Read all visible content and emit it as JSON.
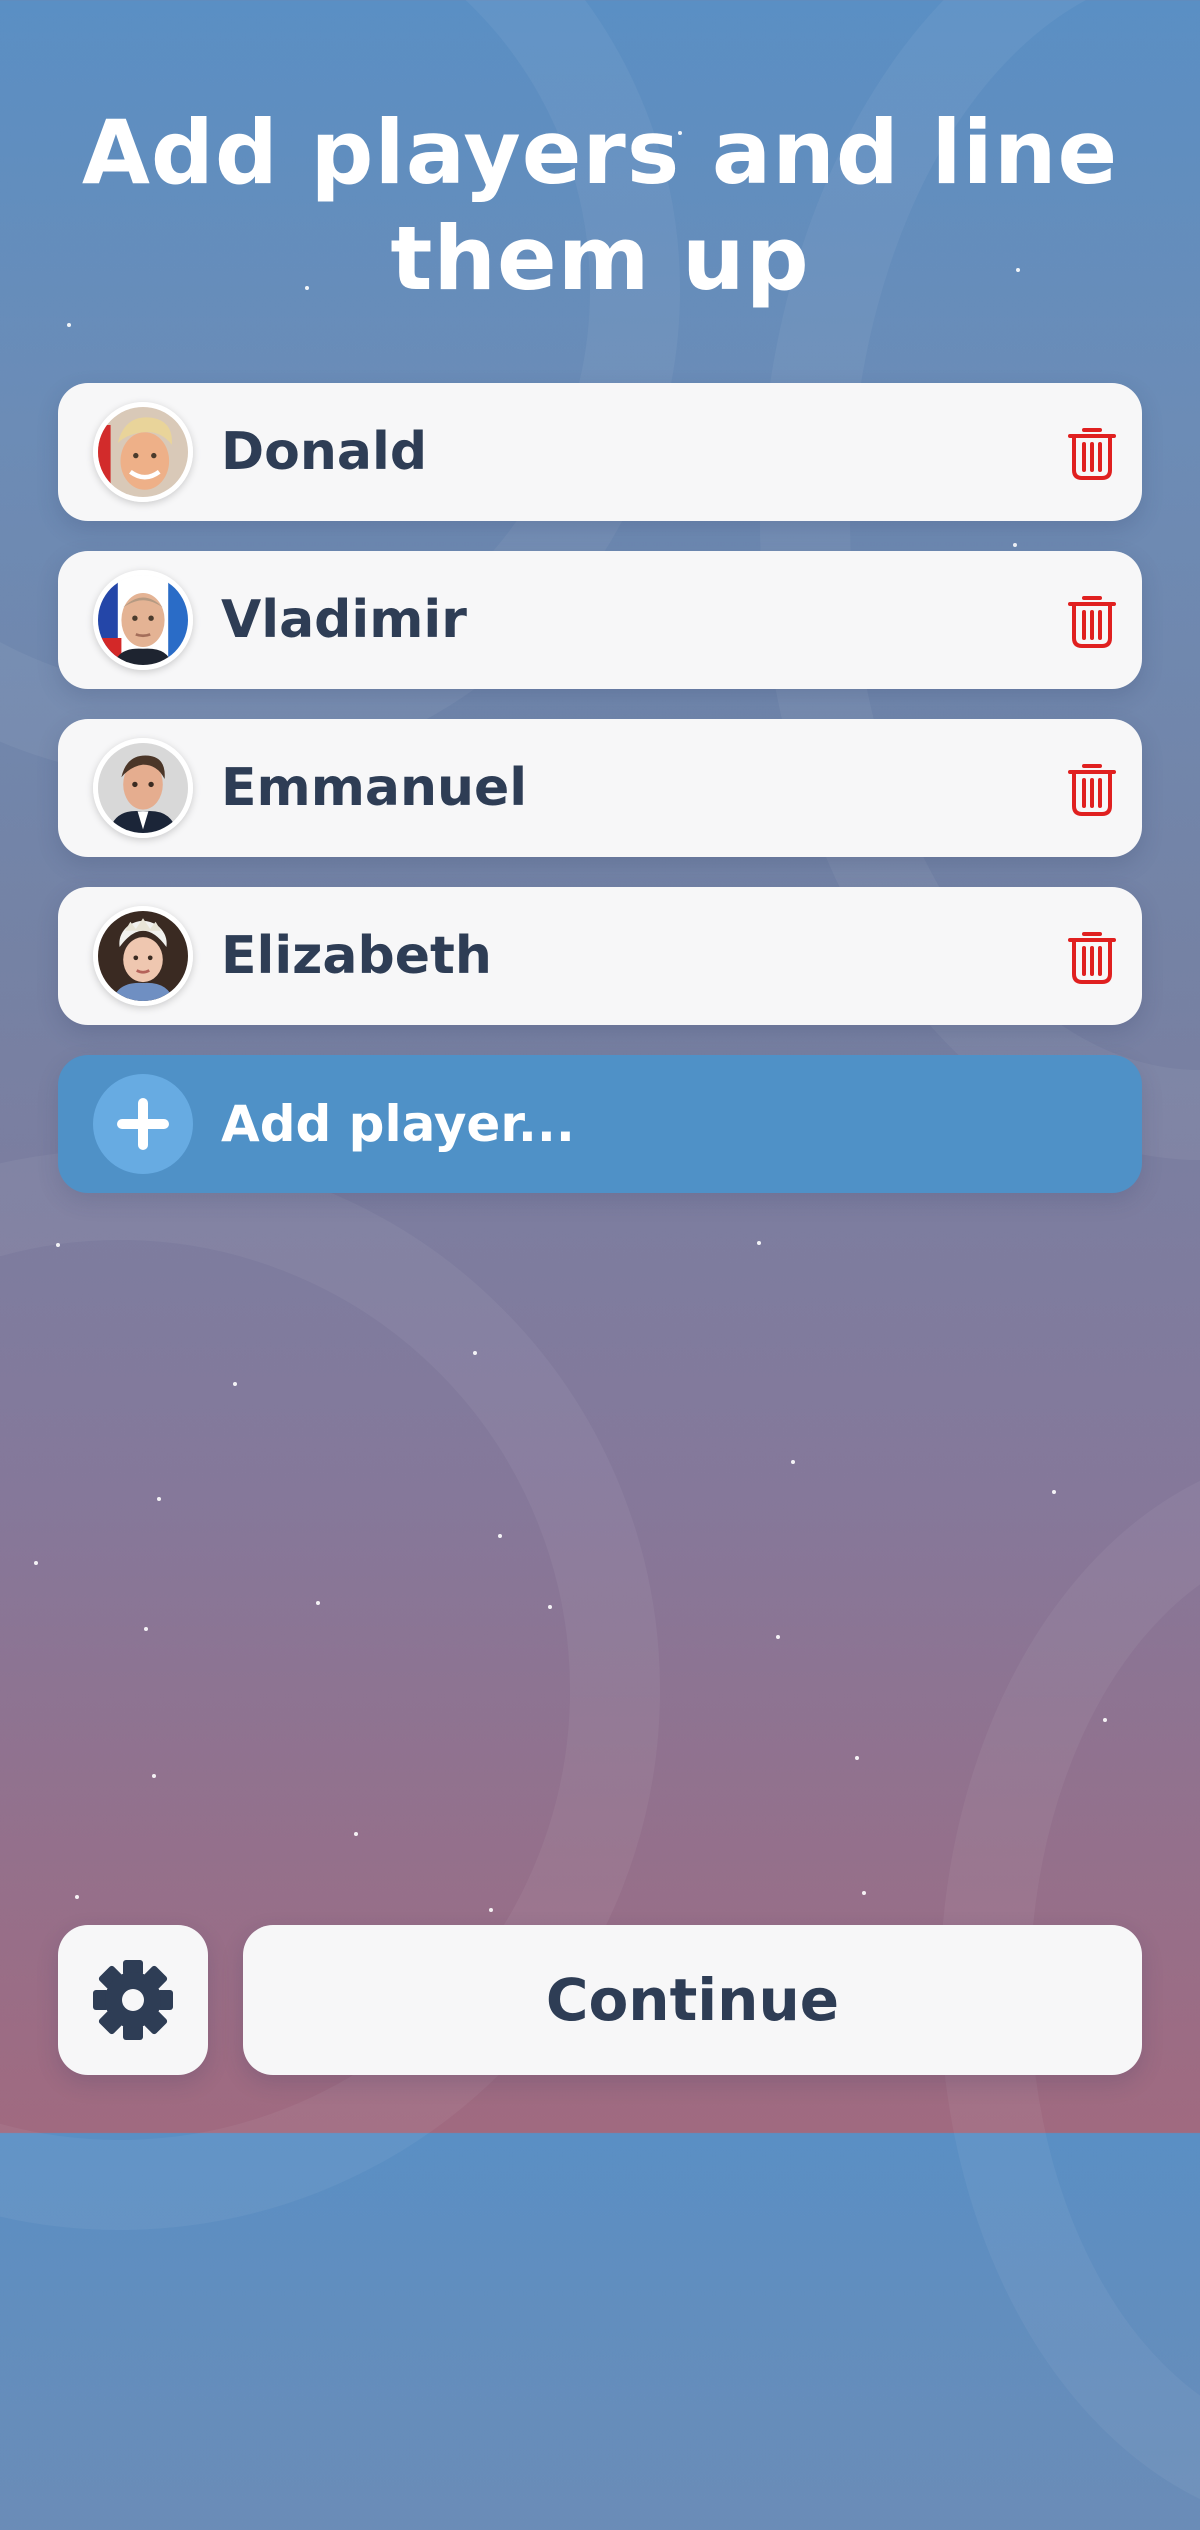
{
  "title": "Add players and line them up",
  "players": [
    {
      "name": "Donald",
      "avatar": "portrait-donald"
    },
    {
      "name": "Vladimir",
      "avatar": "portrait-vladimir"
    },
    {
      "name": "Emmanuel",
      "avatar": "portrait-emmanuel"
    },
    {
      "name": "Elizabeth",
      "avatar": "portrait-elizabeth"
    }
  ],
  "add_player": {
    "label": "Add player...",
    "icon": "plus-icon"
  },
  "footer": {
    "settings_icon": "gear-icon",
    "continue_label": "Continue"
  },
  "colors": {
    "text_dark": "#2e3d55",
    "delete_red": "#e02020",
    "add_button": "#4f91c7",
    "card_bg": "#f7f7f8"
  }
}
